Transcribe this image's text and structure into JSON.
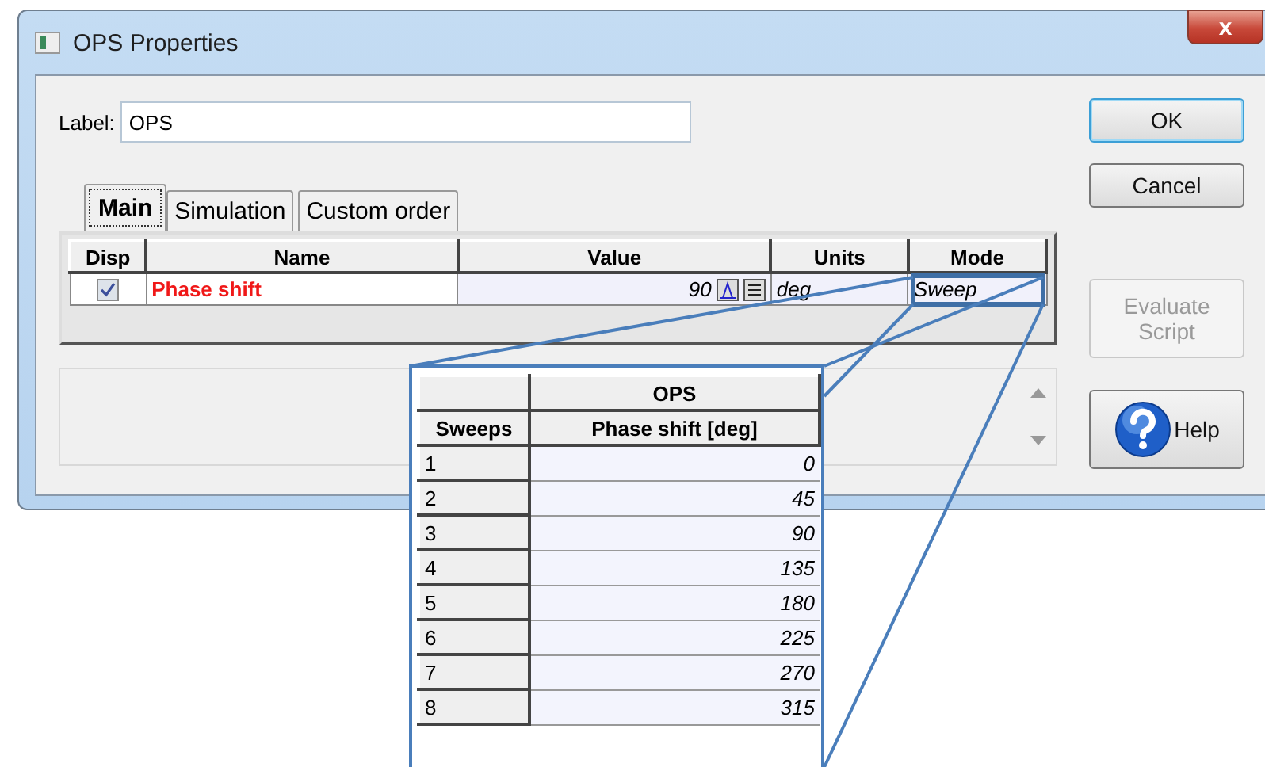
{
  "window": {
    "title": "OPS Properties",
    "close": "x"
  },
  "label_field": {
    "label": "Label:",
    "value": "OPS"
  },
  "tabs": [
    {
      "label": "Main",
      "selected": true
    },
    {
      "label": "Simulation",
      "selected": false
    },
    {
      "label": "Custom order",
      "selected": false
    }
  ],
  "table": {
    "columns": [
      "Disp",
      "Name",
      "Value",
      "Units",
      "Mode"
    ],
    "rows": [
      {
        "disp_checked": true,
        "name": "Phase shift",
        "value": "90",
        "units": "deg",
        "mode": "Sweep"
      }
    ]
  },
  "buttons": [
    {
      "label": "OK",
      "kind": "default",
      "disabled": false
    },
    {
      "label": "Cancel",
      "kind": "plain",
      "disabled": false
    },
    {
      "label": "Evaluate Script",
      "kind": "plain",
      "disabled": true
    },
    {
      "label": "Help",
      "kind": "help",
      "disabled": false
    }
  ],
  "callout": {
    "group_header": "OPS",
    "columns": [
      "Sweeps",
      "Phase shift [deg]"
    ],
    "rows": [
      [
        "1",
        "0"
      ],
      [
        "2",
        "45"
      ],
      [
        "3",
        "90"
      ],
      [
        "4",
        "135"
      ],
      [
        "5",
        "180"
      ],
      [
        "6",
        "225"
      ],
      [
        "7",
        "270"
      ],
      [
        "8",
        "315"
      ]
    ]
  }
}
